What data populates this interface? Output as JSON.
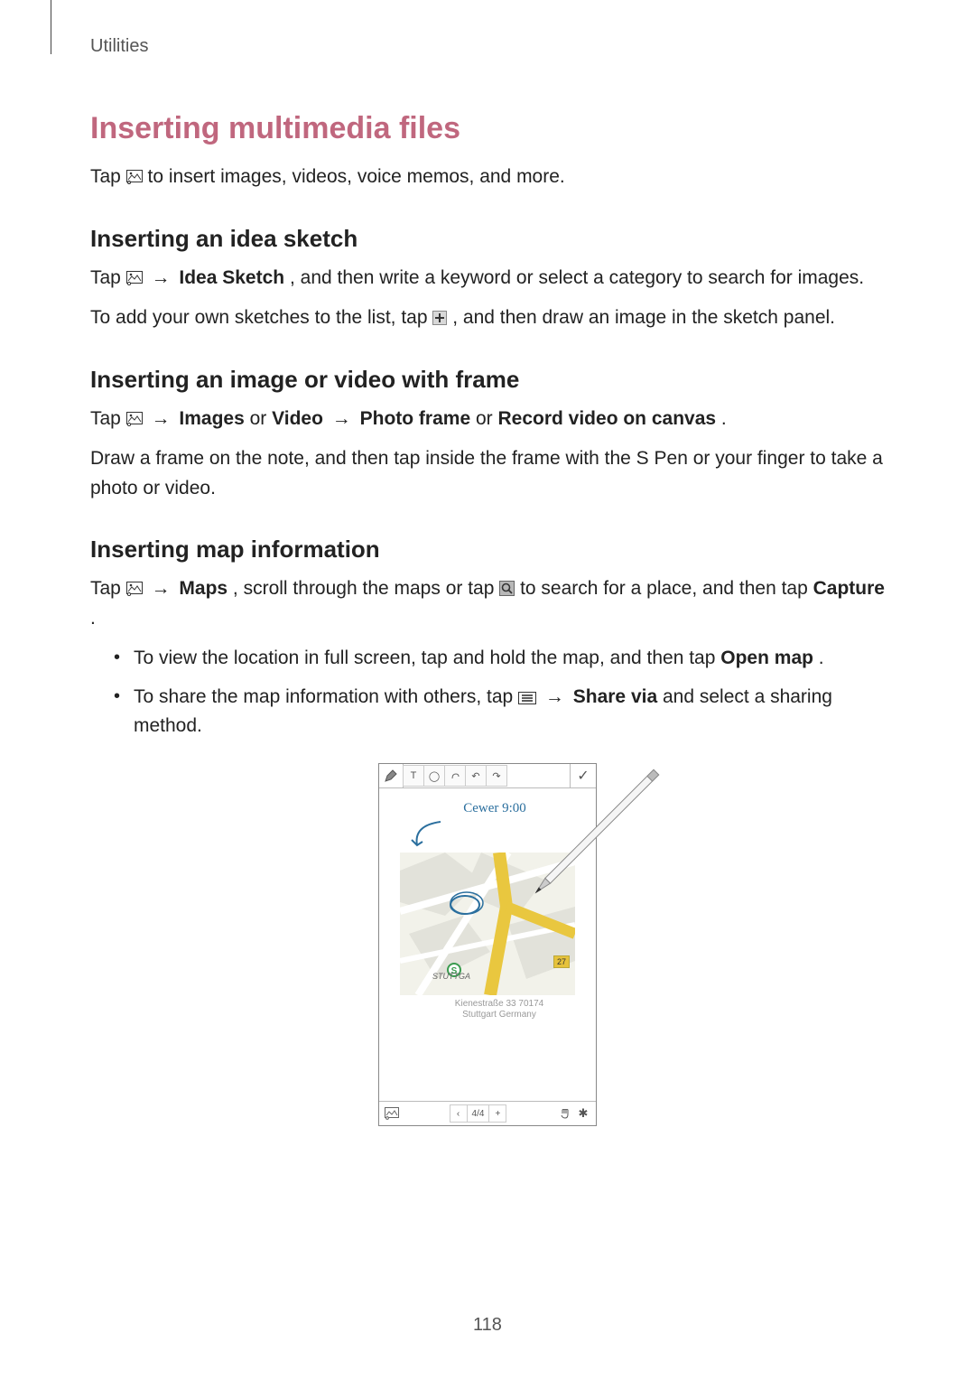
{
  "header": {
    "section": "Utilities"
  },
  "h1": "Inserting multimedia files",
  "p1": {
    "a": "Tap ",
    "b": " to insert images, videos, voice memos, and more."
  },
  "sub_sketch": {
    "title": "Inserting an idea sketch",
    "p1a": "Tap ",
    "p1b": " → ",
    "p1c": "Idea Sketch",
    "p1d": ", and then write a keyword or select a category to search for images.",
    "p2a": "To add your own sketches to the list, tap ",
    "p2b": ", and then draw an image in the sketch panel."
  },
  "sub_frame": {
    "title": "Inserting an image or video with frame",
    "p1a": "Tap ",
    "p1b": " → ",
    "p1c": "Images",
    "p1d": " or ",
    "p1e": "Video",
    "p1f": " → ",
    "p1g": "Photo frame",
    "p1h": " or ",
    "p1i": "Record video on canvas",
    "p1j": ".",
    "p2": "Draw a frame on the note, and then tap inside the frame with the S Pen or your finger to take a photo or video."
  },
  "sub_map": {
    "title": "Inserting map information",
    "p1a": "Tap ",
    "p1b": " → ",
    "p1c": "Maps",
    "p1d": ", scroll through the maps or tap ",
    "p1e": " to search for a place, and then tap ",
    "p1f": "Capture",
    "p1g": ".",
    "b1a": "To view the location in full screen, tap and hold the map, and then tap ",
    "b1b": "Open map",
    "b1c": ".",
    "b2a": "To share the map information with others, tap ",
    "b2b": " → ",
    "b2c": "Share via",
    "b2d": " and select a sharing method."
  },
  "figure": {
    "toolbar": {
      "btn_text": "T",
      "btn_eraser": "◯",
      "btn_undo": "↶",
      "btn_redo": "↷",
      "check": "✓"
    },
    "handwriting": "Cewer 9:00",
    "map_label": "STUTTGA",
    "map_badge": "27",
    "caption_line1": "Kienestraße 33 70174",
    "caption_line2": "Stuttgart Germany",
    "pager_prev": "‹",
    "pager_num": "4/4",
    "pager_add": "+",
    "gear": "✱"
  },
  "page_number": "118"
}
